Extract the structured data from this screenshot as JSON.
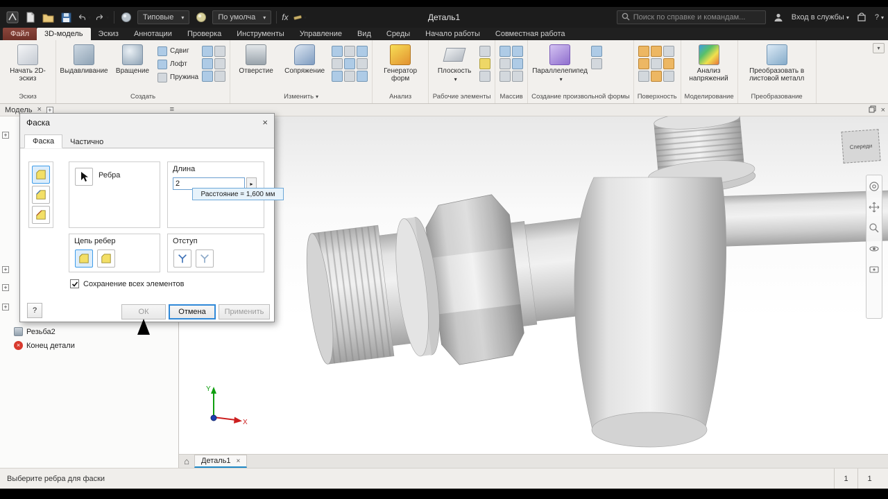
{
  "qat": {
    "doc_title": "Деталь1",
    "styles": "Типовые",
    "appearance": "По умолча",
    "fx": "fx",
    "search_placeholder": "Поиск по справке и командам...",
    "sign_in": "Вход в службы",
    "help": "?"
  },
  "tabs": {
    "items": [
      "Файл",
      "3D-модель",
      "Эскиз",
      "Аннотации",
      "Проверка",
      "Инструменты",
      "Управление",
      "Вид",
      "Среды",
      "Начало работы",
      "Совместная работа"
    ]
  },
  "ribbon": {
    "groups": {
      "sketch": {
        "label": "Эскиз",
        "start": "Начать 2D-эскиз"
      },
      "create": {
        "label": "Создать",
        "extrude": "Выдавливание",
        "revolve": "Вращение",
        "sweep": "Сдвиг",
        "loft": "Лофт",
        "coil": "Пружина"
      },
      "modify": {
        "label": "Изменить",
        "hole": "Отверстие",
        "fillet": "Сопряжение"
      },
      "explore": {
        "label": "Анализ",
        "shape_generator": "Генератор форм"
      },
      "work": {
        "label": "Рабочие элементы",
        "plane": "Плоскость"
      },
      "pattern": {
        "label": "Массив"
      },
      "freeform": {
        "label": "Создание произвольной формы",
        "box": "Параллелепипед"
      },
      "surface": {
        "label": "Поверхность"
      },
      "simulation": {
        "label": "Моделирование",
        "stress": "Анализ напряжений"
      },
      "convert": {
        "label": "Преобразование",
        "sheet": "Преобразовать в листовой металл"
      }
    }
  },
  "browser": {
    "title": "Модель",
    "thread_item": "Резьба2",
    "end_item": "Конец детали"
  },
  "dialog": {
    "title": "Фаска",
    "tab_main": "Фаска",
    "tab_partial": "Частично",
    "edges_label": "Ребра",
    "length_label": "Длина",
    "length_value": "2",
    "tooltip": "Расстояние = 1,600 мм",
    "chain_label": "Цепь ребер",
    "setback_label": "Отступ",
    "preserve_label": "Сохранение всех элементов",
    "ok": "ОК",
    "cancel": "Отмена",
    "apply": "Применить",
    "help": "?"
  },
  "viewport": {
    "viewcube": "Спереди",
    "axis_x": "X",
    "axis_y": "Y"
  },
  "doctab": {
    "label": "Деталь1"
  },
  "status": {
    "message": "Выберите ребра для фаски",
    "n1": "1",
    "n2": "1"
  }
}
